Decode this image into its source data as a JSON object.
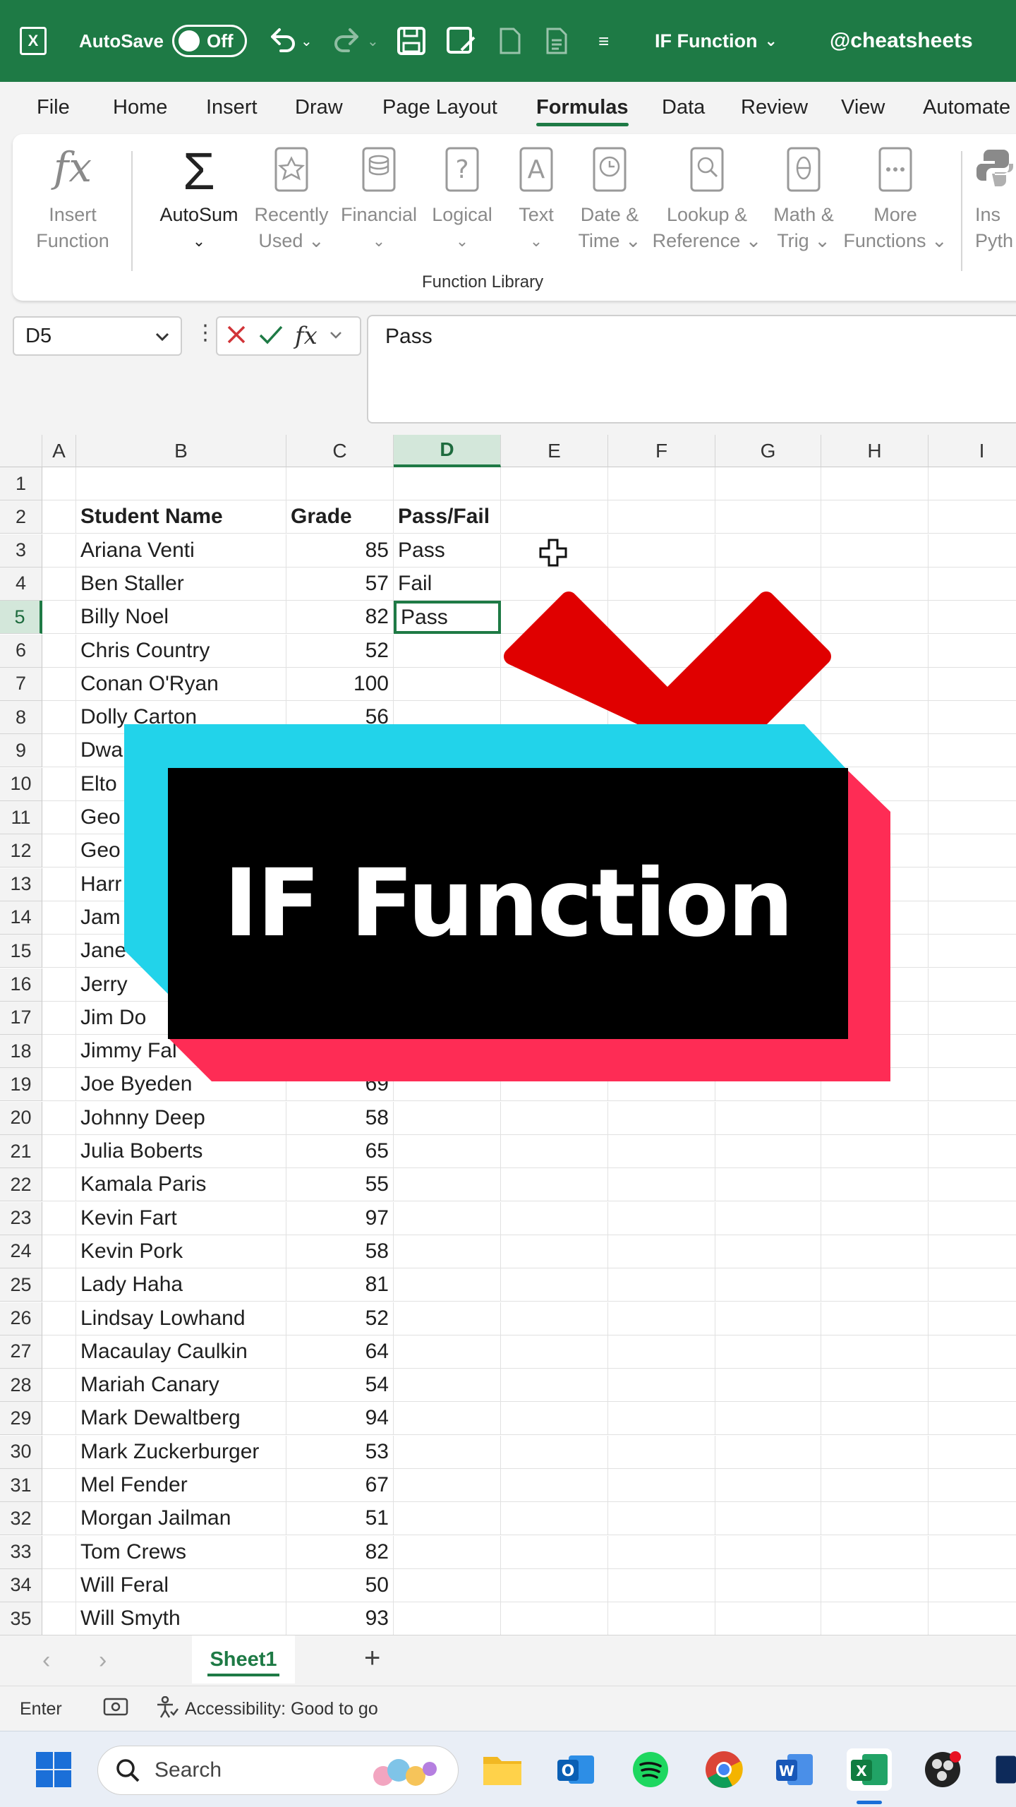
{
  "titlebar": {
    "autosave_label": "AutoSave",
    "autosave_state": "Off",
    "doc_title": "IF Function",
    "handle": "@cheatsheets"
  },
  "menu": {
    "tabs": [
      "File",
      "Home",
      "Insert",
      "Draw",
      "Page Layout",
      "Formulas",
      "Data",
      "Review",
      "View",
      "Automate"
    ],
    "active": "Formulas"
  },
  "ribbon": {
    "insert_function": [
      "Insert",
      "Function"
    ],
    "autosum": "AutoSum",
    "recently_used": [
      "Recently",
      "Used"
    ],
    "financial": "Financial",
    "logical": "Logical",
    "text": "Text",
    "date_time": [
      "Date &",
      "Time"
    ],
    "lookup_reference": [
      "Lookup &",
      "Reference"
    ],
    "math_trig": [
      "Math &",
      "Trig"
    ],
    "more_functions": [
      "More",
      "Functions"
    ],
    "python_cut": [
      "Ins",
      "Pyth"
    ],
    "group_label": "Function Library"
  },
  "formula_bar": {
    "name_box": "D5",
    "formula": "Pass"
  },
  "grid": {
    "columns": [
      "A",
      "B",
      "C",
      "D",
      "E",
      "F",
      "G",
      "H",
      "I"
    ],
    "selected_column": "D",
    "selected_row": 5,
    "headers": {
      "name": "Student Name",
      "grade": "Grade",
      "result": "Pass/Fail"
    },
    "rows": [
      {
        "name": "Ariana Venti",
        "grade": "85",
        "result": "Pass"
      },
      {
        "name": "Ben Staller",
        "grade": "57",
        "result": "Fail"
      },
      {
        "name": "Billy Noel",
        "grade": "82",
        "result": "Pass"
      },
      {
        "name": "Chris Country",
        "grade": "52",
        "result": ""
      },
      {
        "name": "Conan O'Ryan",
        "grade": "100",
        "result": ""
      },
      {
        "name": "Dolly Carton",
        "grade": "56",
        "result": ""
      },
      {
        "name": "Dwa",
        "grade": "",
        "result": ""
      },
      {
        "name": "Elto",
        "grade": "",
        "result": ""
      },
      {
        "name": "Geo",
        "grade": "",
        "result": ""
      },
      {
        "name": "Geo",
        "grade": "",
        "result": ""
      },
      {
        "name": "Harr",
        "grade": "",
        "result": ""
      },
      {
        "name": "Jam",
        "grade": "",
        "result": ""
      },
      {
        "name": "Jane",
        "grade": "",
        "result": ""
      },
      {
        "name": "Jerry",
        "grade": "",
        "result": ""
      },
      {
        "name": "Jim Do",
        "grade": "",
        "result": ""
      },
      {
        "name": "Jimmy Fal",
        "grade": "",
        "result": ""
      },
      {
        "name": "Joe Byeden",
        "grade": "69",
        "result": ""
      },
      {
        "name": "Johnny Deep",
        "grade": "58",
        "result": ""
      },
      {
        "name": "Julia Boberts",
        "grade": "65",
        "result": ""
      },
      {
        "name": "Kamala Paris",
        "grade": "55",
        "result": ""
      },
      {
        "name": "Kevin Fart",
        "grade": "97",
        "result": ""
      },
      {
        "name": "Kevin Pork",
        "grade": "58",
        "result": ""
      },
      {
        "name": "Lady Haha",
        "grade": "81",
        "result": ""
      },
      {
        "name": "Lindsay Lowhand",
        "grade": "52",
        "result": ""
      },
      {
        "name": "Macaulay Caulkin",
        "grade": "64",
        "result": ""
      },
      {
        "name": "Mariah Canary",
        "grade": "54",
        "result": ""
      },
      {
        "name": "Mark Dewaltberg",
        "grade": "94",
        "result": ""
      },
      {
        "name": "Mark Zuckerburger",
        "grade": "53",
        "result": ""
      },
      {
        "name": "Mel Fender",
        "grade": "67",
        "result": ""
      },
      {
        "name": "Morgan Jailman",
        "grade": "51",
        "result": ""
      },
      {
        "name": "Tom Crews",
        "grade": "82",
        "result": ""
      },
      {
        "name": "Will Feral",
        "grade": "50",
        "result": ""
      },
      {
        "name": "Will Smyth",
        "grade": "93",
        "result": ""
      }
    ]
  },
  "sheet_tabs": {
    "active": "Sheet1",
    "add": "+"
  },
  "status": {
    "mode": "Enter",
    "accessibility": "Accessibility: Good to go"
  },
  "taskbar": {
    "search_placeholder": "Search"
  },
  "overlay": {
    "title": "IF Function"
  },
  "colors": {
    "excel_green": "#1e7a45",
    "banner_cyan": "#22d3ea",
    "banner_red": "#fe2c55",
    "banner_black": "#000000",
    "x_red": "#e00000"
  }
}
